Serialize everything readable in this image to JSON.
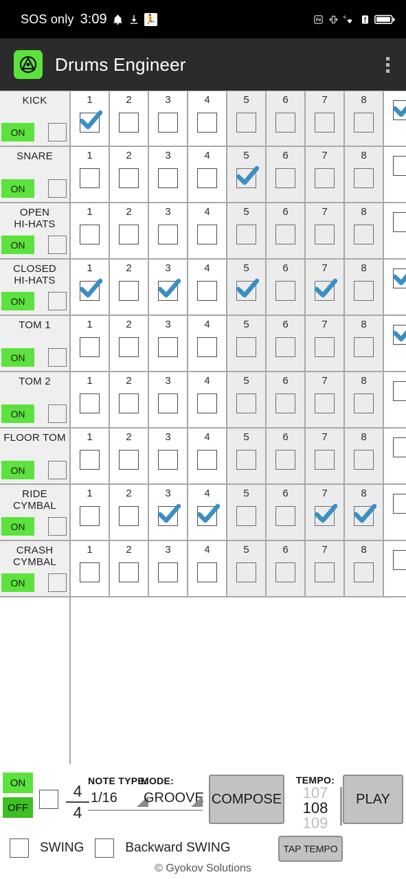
{
  "statusbar": {
    "carrier": "SOS only",
    "time": "3:09",
    "icons_left": [
      "bell-icon",
      "download-icon",
      "running-app-icon"
    ],
    "icons_right": [
      "nfc-icon",
      "vibrate-icon",
      "wifi-6-icon",
      "signal-alert-icon",
      "battery-icon"
    ]
  },
  "appbar": {
    "title": "Drums Engineer",
    "logo": "drums-engineer-logo",
    "overflow": "overflow-menu-icon",
    "logo_color": "#5ce23d"
  },
  "grid": {
    "step_numbers": [
      1,
      2,
      3,
      4,
      5,
      6,
      7,
      8
    ],
    "on_label": "ON",
    "rows": [
      {
        "name": "KICK",
        "enabled": "ON",
        "steps": [
          1,
          0,
          0,
          0,
          0,
          0,
          0,
          0
        ],
        "partial_next": 1
      },
      {
        "name": "SNARE",
        "enabled": "ON",
        "steps": [
          0,
          0,
          0,
          0,
          1,
          0,
          0,
          0
        ],
        "partial_next": 0
      },
      {
        "name": "OPEN\nHI-HATS",
        "enabled": "ON",
        "steps": [
          0,
          0,
          0,
          0,
          0,
          0,
          0,
          0
        ],
        "partial_next": 0
      },
      {
        "name": "CLOSED\nHI-HATS",
        "enabled": "ON",
        "steps": [
          1,
          0,
          1,
          0,
          1,
          0,
          1,
          0
        ],
        "partial_next": 1
      },
      {
        "name": "TOM 1",
        "enabled": "ON",
        "steps": [
          0,
          0,
          0,
          0,
          0,
          0,
          0,
          0
        ],
        "partial_next": 1
      },
      {
        "name": "TOM 2",
        "enabled": "ON",
        "steps": [
          0,
          0,
          0,
          0,
          0,
          0,
          0,
          0
        ],
        "partial_next": 0
      },
      {
        "name": "FLOOR TOM",
        "enabled": "ON",
        "steps": [
          0,
          0,
          0,
          0,
          0,
          0,
          0,
          0
        ],
        "partial_next": 0
      },
      {
        "name": "RIDE\nCYMBAL",
        "enabled": "ON",
        "steps": [
          0,
          0,
          1,
          1,
          0,
          0,
          1,
          1
        ],
        "partial_next": 0
      },
      {
        "name": "CRASH\nCYMBAL",
        "enabled": "ON",
        "steps": [
          0,
          0,
          0,
          0,
          0,
          0,
          0,
          0
        ],
        "partial_next": 0
      }
    ]
  },
  "controls": {
    "power_on": "ON",
    "power_off": "OFF",
    "time_signature_top": "4",
    "time_signature_bottom": "4",
    "note_type_label": "NOTE TYPE:",
    "note_type_value": "1/16",
    "mode_label": "MODE:",
    "mode_value": "GROOVE",
    "compose": "COMPOSE",
    "play": "PLAY",
    "tempo_label": "TEMPO:",
    "tempo_prev": "107",
    "tempo_current": "108",
    "tempo_next": "109",
    "tap_tempo": "TAP TEMPO",
    "swing": "SWING",
    "backward_swing": "Backward SWING"
  },
  "footer": {
    "copyright": "© Gyokov Solutions"
  },
  "colors": {
    "accent_green": "#5ce23d",
    "check_blue": "#3a8fc4",
    "button_gray": "#c2c2c2"
  }
}
